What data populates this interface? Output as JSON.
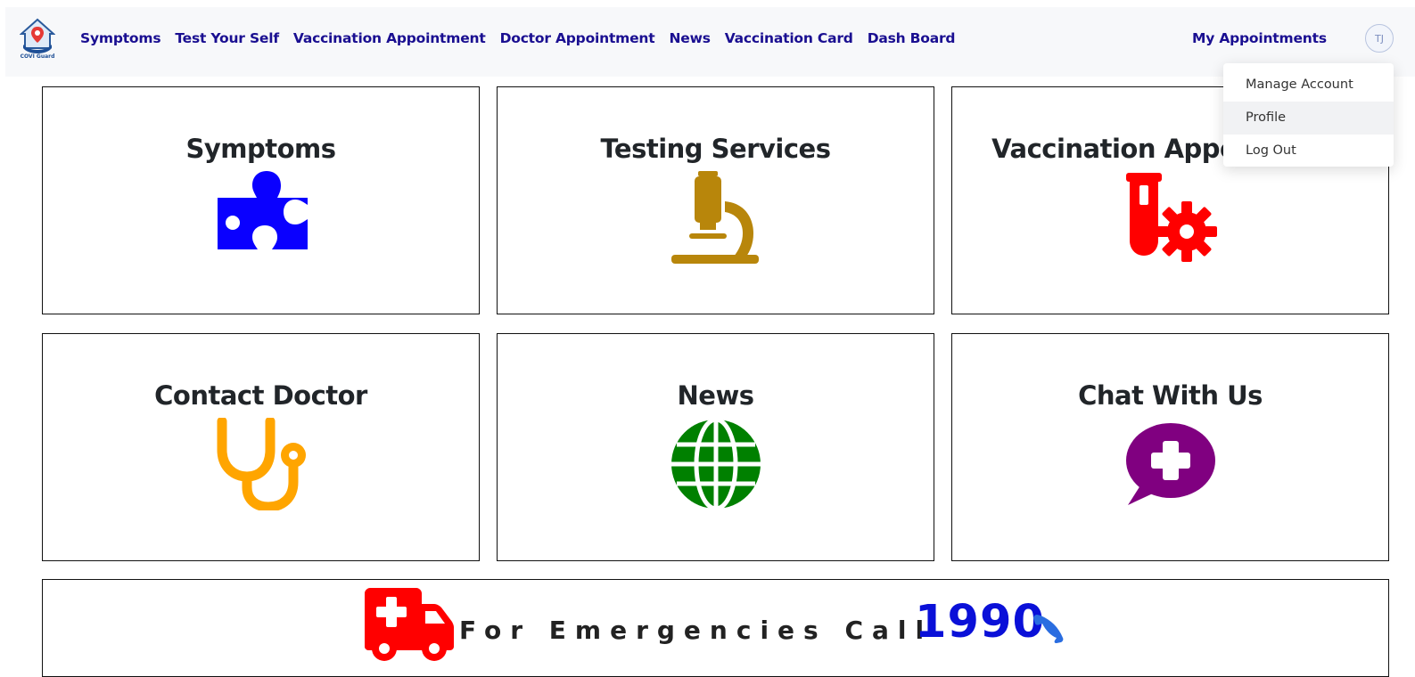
{
  "brand": {
    "logo_text": "COVI Guard"
  },
  "nav": {
    "links": [
      "Symptoms",
      "Test Your Self",
      "Vaccination Appointment",
      "Doctor Appointment",
      "News",
      "Vaccination Card",
      "Dash Board"
    ],
    "my_appointments": "My Appointments",
    "avatar_initials": "TJ"
  },
  "user_menu": {
    "items": [
      "Manage Account",
      "Profile",
      "Log Out"
    ],
    "highlighted": "Profile"
  },
  "cards": [
    {
      "title": "Symptoms",
      "icon": "puzzle-icon",
      "color": "#0a00ff"
    },
    {
      "title": "Testing Services",
      "icon": "microscope-icon",
      "color": "#b8860b"
    },
    {
      "title": "Vaccination Appointment",
      "icon": "vial-gear-icon",
      "color": "#ff0000"
    },
    {
      "title": "Contact Doctor",
      "icon": "stethoscope-icon",
      "color": "#ffa500"
    },
    {
      "title": "News",
      "icon": "globe-icon",
      "color": "#008000"
    },
    {
      "title": "Chat With Us",
      "icon": "medical-chat-icon",
      "color": "#800080"
    }
  ],
  "emergency": {
    "label": "For Emergencies Call",
    "number": "1990",
    "ambulance_color": "#ff0000",
    "number_color": "#0a10d8",
    "phone_color": "#2a6de0"
  }
}
